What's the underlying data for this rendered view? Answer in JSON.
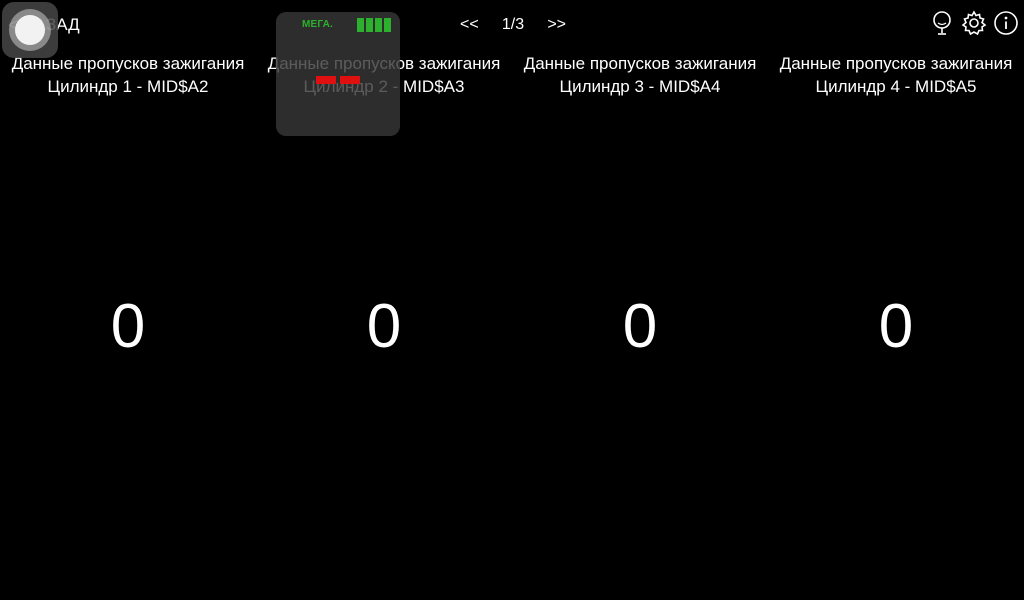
{
  "header": {
    "back_chevron": "<",
    "back_label": "НАЗАД",
    "pager_prev": "<<",
    "pager_current": "1/3",
    "pager_next": ">>",
    "icons": [
      "microphone-icon",
      "gear-icon",
      "info-icon"
    ]
  },
  "columns": [
    {
      "title": "Данные пропусков зажигания Цилиндр 1 - MID$A2",
      "value": "0"
    },
    {
      "title": "Данные пропусков зажигания Цилиндр 2 - MID$A3",
      "value": "0"
    },
    {
      "title": "Данные пропусков зажигания Цилиндр 3 - MID$A4",
      "value": "0"
    },
    {
      "title": "Данные пропусков зажигания Цилиндр 4 - MID$A5",
      "value": "0"
    }
  ],
  "adapter": {
    "brand": "МЕГА.",
    "signal_bars": 4,
    "led_color": "#e01010",
    "brand_color": "#2db02d"
  },
  "colors": {
    "background": "#000000",
    "text": "#ffffff"
  }
}
